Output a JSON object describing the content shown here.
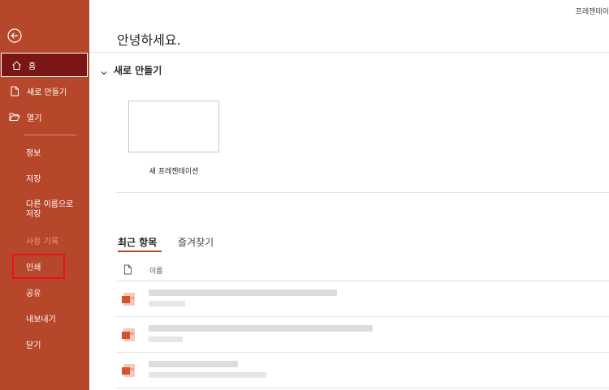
{
  "app": {
    "title": "프레젠테이"
  },
  "sidebar": {
    "items": [
      {
        "label": "홈",
        "icon": "home-icon"
      },
      {
        "label": "새로 만들기",
        "icon": "new-document-icon"
      },
      {
        "label": "열기",
        "icon": "open-folder-icon"
      },
      {
        "label": "정보"
      },
      {
        "label": "저장"
      },
      {
        "label": "다른 이름으로\n저장"
      },
      {
        "label": "사용 기록"
      },
      {
        "label": "인쇄"
      },
      {
        "label": "공유"
      },
      {
        "label": "내보내기"
      },
      {
        "label": "닫기"
      }
    ]
  },
  "main": {
    "greeting": "안녕하세요.",
    "new_section": {
      "title": "새로 만들기"
    },
    "new_tile": {
      "label": "새 프레젠테이션"
    },
    "tabs": [
      {
        "label": "최근 항목"
      },
      {
        "label": "즐겨찾기"
      }
    ],
    "columns": {
      "name": "이름"
    }
  },
  "colors": {
    "accent": "#b7472a",
    "active_item": "#7a1616",
    "highlight": "#e81123"
  }
}
